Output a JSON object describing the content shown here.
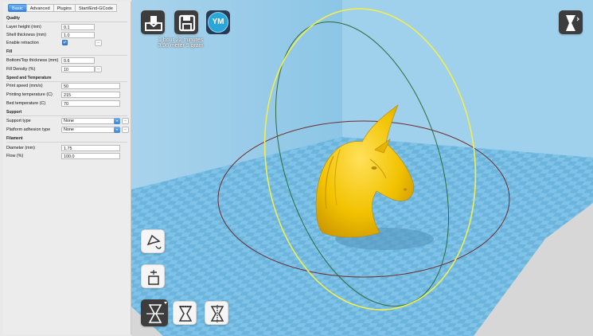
{
  "tabs": [
    {
      "label": "Basic",
      "active": true
    },
    {
      "label": "Advanced",
      "active": false
    },
    {
      "label": "Plugins",
      "active": false
    },
    {
      "label": "Start/End-GCode",
      "active": false
    }
  ],
  "quality": {
    "title": "Quality",
    "layer_height": {
      "label": "Layer height (mm)",
      "value": "0.1"
    },
    "shell_thickness": {
      "label": "Shell thickness (mm)",
      "value": "1.0"
    },
    "enable_retraction": {
      "label": "Enable retraction",
      "checked": true,
      "more": "..."
    }
  },
  "fill": {
    "title": "Fill",
    "bottom_top": {
      "label": "Bottom/Top thickness (mm)",
      "value": "0.6"
    },
    "density": {
      "label": "Fill Density (%)",
      "value": "10",
      "more": "..."
    }
  },
  "speed": {
    "title": "Speed and Temperature",
    "print_speed": {
      "label": "Print speed (mm/s)",
      "value": "50"
    },
    "print_temp": {
      "label": "Printing temperature (C)",
      "value": "215"
    },
    "bed_temp": {
      "label": "Bed temperature (C)",
      "value": "70"
    }
  },
  "support": {
    "title": "Support",
    "support_type": {
      "label": "Support type",
      "value": "None",
      "more": "..."
    },
    "adhesion": {
      "label": "Platform adhesion type",
      "value": "None",
      "more": "..."
    }
  },
  "filament": {
    "title": "Filament",
    "diameter": {
      "label": "Diameter (mm)",
      "value": "1.75"
    },
    "flow": {
      "label": "Flow (%)",
      "value": "100.0"
    }
  },
  "print_info": {
    "time": "1 hour 22 minutes",
    "material": "3.98 meter 9 gram"
  },
  "viewport": {
    "ym_label": "YM",
    "model_color": "#f2c200",
    "bed_color": "#7fc3e8",
    "bed_checker_color": "#6fb6dd",
    "wall_color": "#d7d7d7"
  },
  "icons": [
    "load-icon",
    "save-icon",
    "ym-icon",
    "view-mode-icon",
    "rotate-icon",
    "scale-icon",
    "mirror-icon",
    "mirror-x-icon",
    "mirror-y-icon"
  ]
}
